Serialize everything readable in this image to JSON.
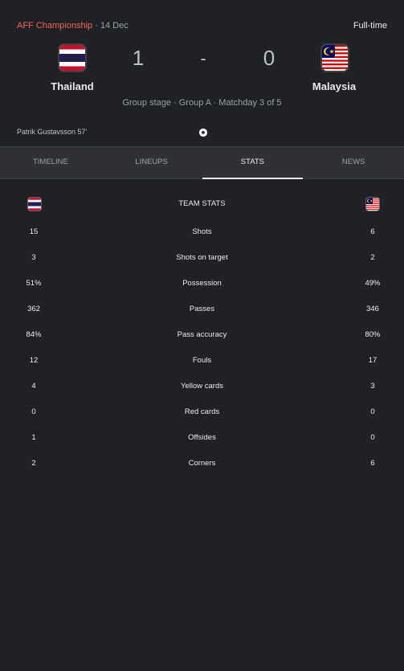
{
  "match": {
    "competition": "AFF Championship",
    "date": "· 14 Dec",
    "status": "Full-time",
    "home": {
      "name": "Thailand",
      "score": "1",
      "flag": "thailand-flag"
    },
    "away": {
      "name": "Malaysia",
      "score": "0",
      "flag": "malaysia-flag"
    },
    "separator": "-",
    "stage": "Group stage · Group A · Matchday 3 of 5",
    "scorer": "Patrik Gustavsson 57'"
  },
  "tabs": [
    {
      "label": "TIMELINE",
      "active": false
    },
    {
      "label": "LINEUPS",
      "active": false
    },
    {
      "label": "STATS",
      "active": true
    },
    {
      "label": "NEWS",
      "active": false
    }
  ],
  "stats": {
    "title": "TEAM STATS",
    "rows": [
      {
        "home": "15",
        "label": "Shots",
        "away": "6"
      },
      {
        "home": "3",
        "label": "Shots on target",
        "away": "2"
      },
      {
        "home": "51%",
        "label": "Possession",
        "away": "49%"
      },
      {
        "home": "362",
        "label": "Passes",
        "away": "346"
      },
      {
        "home": "84%",
        "label": "Pass accuracy",
        "away": "80%"
      },
      {
        "home": "12",
        "label": "Fouls",
        "away": "17"
      },
      {
        "home": "4",
        "label": "Yellow cards",
        "away": "3"
      },
      {
        "home": "0",
        "label": "Red cards",
        "away": "0"
      },
      {
        "home": "1",
        "label": "Offsides",
        "away": "0"
      },
      {
        "home": "2",
        "label": "Corners",
        "away": "6"
      }
    ]
  },
  "colors": {
    "background": "#202124",
    "accent": "#ee675c",
    "tab_bar": "#303134"
  }
}
